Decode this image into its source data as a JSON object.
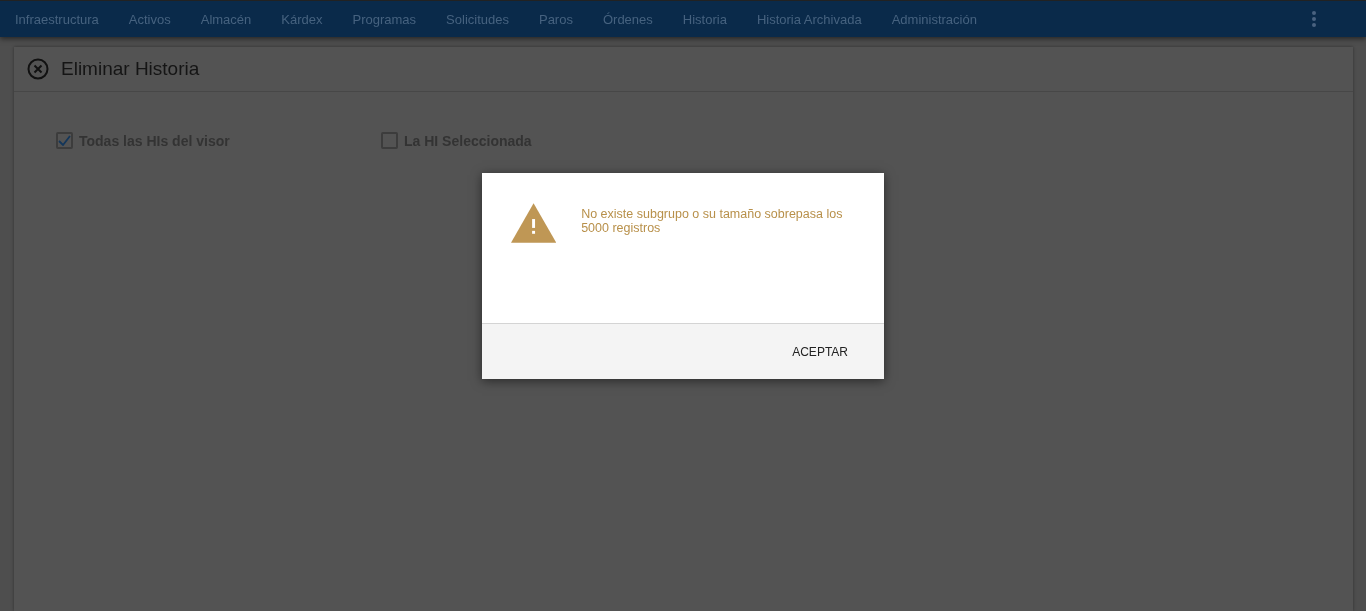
{
  "nav": {
    "items": [
      {
        "label": "Infraestructura"
      },
      {
        "label": "Activos"
      },
      {
        "label": "Almacén"
      },
      {
        "label": "Kárdex"
      },
      {
        "label": "Programas"
      },
      {
        "label": "Solicitudes"
      },
      {
        "label": "Paros"
      },
      {
        "label": "Órdenes"
      },
      {
        "label": "Historia"
      },
      {
        "label": "Historia Archivada"
      },
      {
        "label": "Administración"
      }
    ]
  },
  "panel": {
    "title": "Eliminar Historia",
    "options": [
      {
        "label": "Todas las HIs del visor",
        "checked": true
      },
      {
        "label": "La HI Seleccionada",
        "checked": false
      }
    ]
  },
  "dialog": {
    "message": "No existe subgrupo o su tamaño sobrepasa los 5000 registros",
    "buttons": [
      "ACEPTAR"
    ]
  }
}
